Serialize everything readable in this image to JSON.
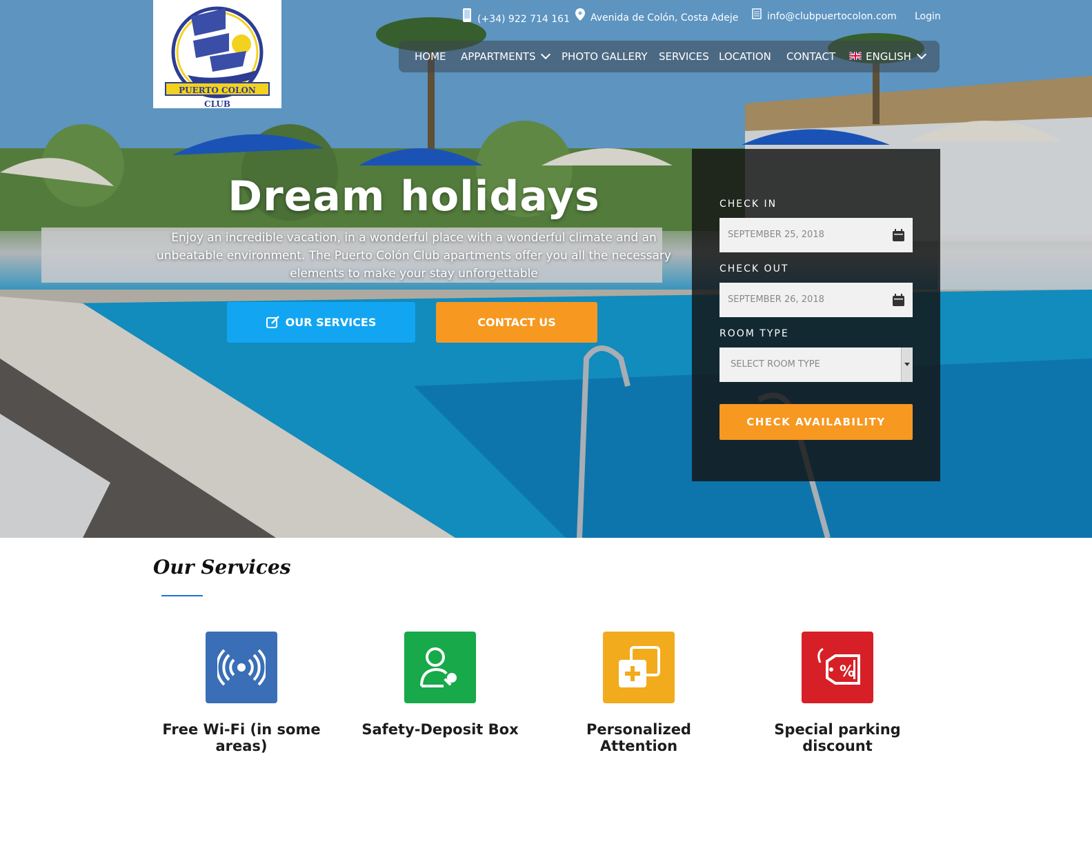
{
  "topbar": {
    "phone": "(+34) 922 714 161",
    "address": "Avenida de Colón, Costa Adeje",
    "email": "info@clubpuertocolon.com",
    "login": "Login"
  },
  "logo": {
    "text": "PUERTO COLON CLUB"
  },
  "nav": {
    "home": "HOME",
    "apartments": "APPARTMENTS",
    "gallery": "PHOTO GALLERY",
    "services": "SERVICES",
    "location": "LOCATION",
    "contact": "CONTACT",
    "language": "ENGLISH"
  },
  "hero": {
    "title": "Dream holidays",
    "subtitle": "Enjoy an incredible vacation, in a wonderful place with a wonderful climate and an unbeatable environment. The Puerto Colón Club apartments offer you all the necessary elements to make your stay unforgettable",
    "services_button": "OUR SERVICES",
    "contact_button": "CONTACT US"
  },
  "booking": {
    "checkin_label": "CHECK IN",
    "checkin_value": "SEPTEMBER 25, 2018",
    "checkout_label": "CHECK OUT",
    "checkout_value": "SEPTEMBER 26, 2018",
    "roomtype_label": "ROOM TYPE",
    "roomtype_value": "SELECT ROOM TYPE",
    "check_button": "CHECK AVAILABILITY"
  },
  "services": {
    "heading": "Our Services",
    "items": [
      {
        "label": "Free Wi-Fi (in some areas)",
        "color": "#3a6fb7",
        "icon": "wifi-icon"
      },
      {
        "label": "Safety-Deposit Box",
        "color": "#17a94a",
        "icon": "user-key-icon"
      },
      {
        "label": "Personalized Attention",
        "color": "#f2ab1c",
        "icon": "plus-copy-icon"
      },
      {
        "label": "Special parking discount",
        "color": "#d71f27",
        "icon": "discount-tag-icon"
      }
    ]
  }
}
